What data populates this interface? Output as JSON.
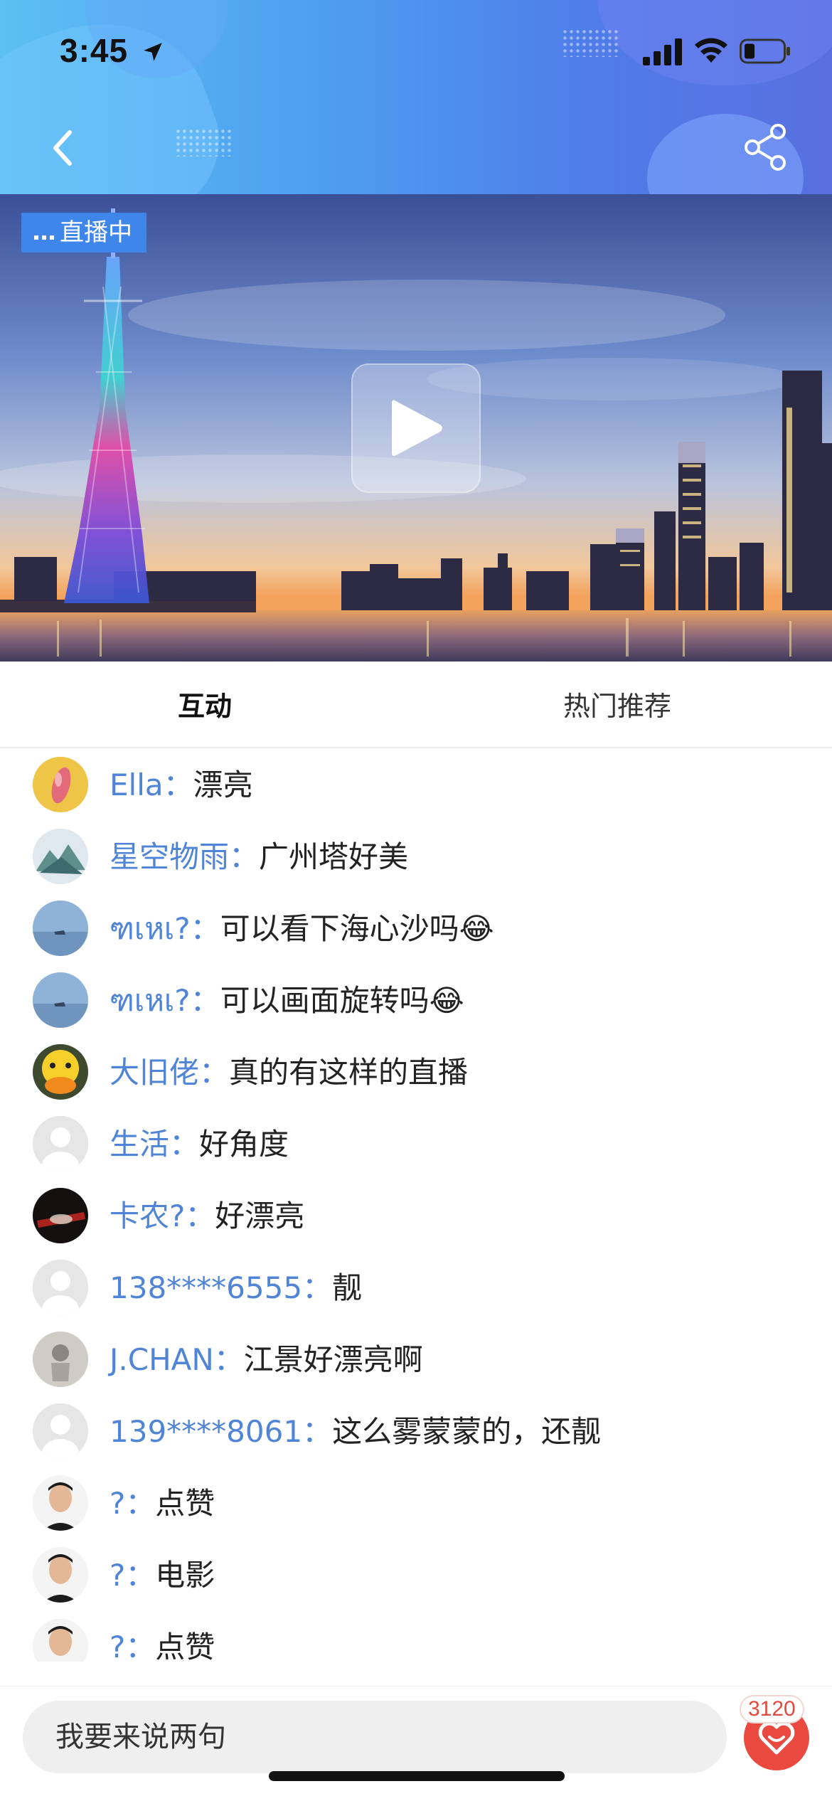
{
  "status_bar": {
    "time": "3:45",
    "icons": [
      "location-arrow-icon",
      "cellular-signal-icon",
      "wifi-icon",
      "battery-icon"
    ]
  },
  "header": {
    "back_icon": "chevron-left-icon",
    "share_icon": "share-icon"
  },
  "video": {
    "live_badge": "直播中",
    "play_icon": "play-icon"
  },
  "tabs": [
    {
      "label": "互动",
      "active": true
    },
    {
      "label": "热门推荐",
      "active": false
    }
  ],
  "comments": [
    {
      "name": "Ella：",
      "text": "漂亮"
    },
    {
      "name": "星空物雨：",
      "text": "广州塔好美"
    },
    {
      "name": "ฑเหเ?：",
      "text": "可以看下海心沙吗😂"
    },
    {
      "name": "ฑเหเ?：",
      "text": "可以画面旋转吗😂"
    },
    {
      "name": "大旧佬：",
      "text": "真的有这样的直播"
    },
    {
      "name": "生活：",
      "text": "好角度"
    },
    {
      "name": "卡农?：",
      "text": "好漂亮"
    },
    {
      "name": "138****6555：",
      "text": "靓"
    },
    {
      "name": "J.CHAN：",
      "text": "江景好漂亮啊"
    },
    {
      "name": "139****8061：",
      "text": "这么雾蒙蒙的，还靓"
    },
    {
      "name": "?：",
      "text": "点赞"
    },
    {
      "name": "?：",
      "text": "电影"
    },
    {
      "name": "?：",
      "text": "点赞"
    }
  ],
  "bottom_bar": {
    "input_placeholder": "我要来说两句",
    "like_count": "3120",
    "like_icon": "heart-icon"
  },
  "colors": {
    "accent_blue": "#4f84d6",
    "live_badge": "#3f86ea",
    "like_red": "#e9493f"
  }
}
